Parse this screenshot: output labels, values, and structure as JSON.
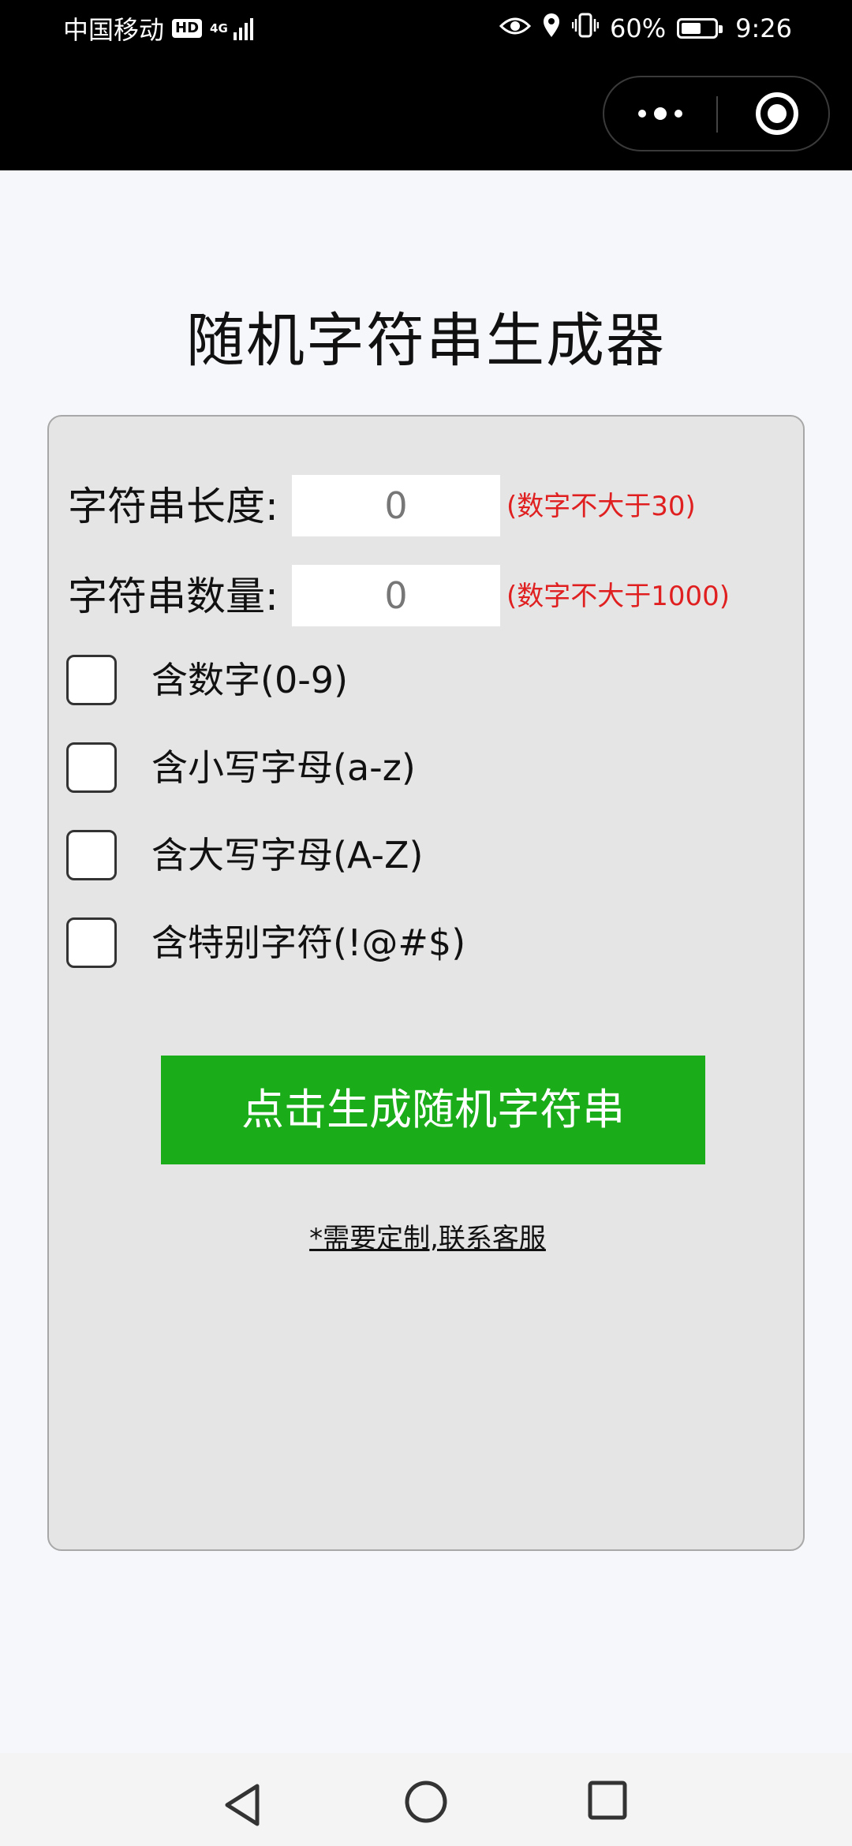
{
  "status_bar": {
    "carrier": "中国移动",
    "hd": "HD",
    "network": "4G",
    "battery_percent": "60%",
    "battery_level": 0.6,
    "time": "9:26"
  },
  "page": {
    "title": "随机字符串生成器"
  },
  "form": {
    "length_label": "字符串长度:",
    "length_value": "0",
    "length_hint": "(数字不大于30)",
    "count_label": "字符串数量:",
    "count_value": "0",
    "count_hint": "(数字不大于1000)",
    "options": [
      {
        "label": "含数字(0-9)",
        "checked": false
      },
      {
        "label": "含小写字母(a-z)",
        "checked": false
      },
      {
        "label": "含大写字母(A-Z)",
        "checked": false
      },
      {
        "label": "含特别字符(!@#$)",
        "checked": false
      }
    ],
    "generate_button": "点击生成随机字符串",
    "contact_link": "*需要定制,联系客服"
  },
  "colors": {
    "button": "#1aad19",
    "hint": "#e02020",
    "card": "#e5e5e5",
    "background": "#f6f7fb"
  }
}
